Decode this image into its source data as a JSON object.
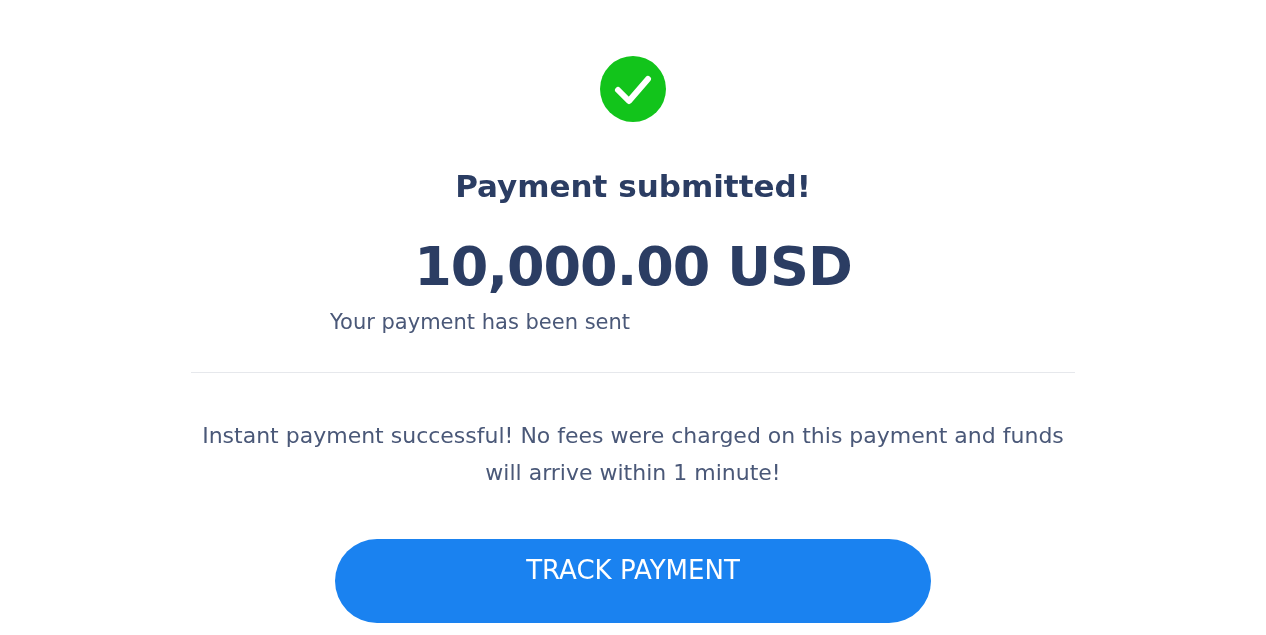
{
  "title": "Payment submitted!",
  "amount": "10,000.00 USD",
  "recipient_note": "Your payment has been sent",
  "message": "Instant payment successful! No fees were charged on this payment and funds will arrive within 1 minute!",
  "button": "TRACK PAYMENT"
}
